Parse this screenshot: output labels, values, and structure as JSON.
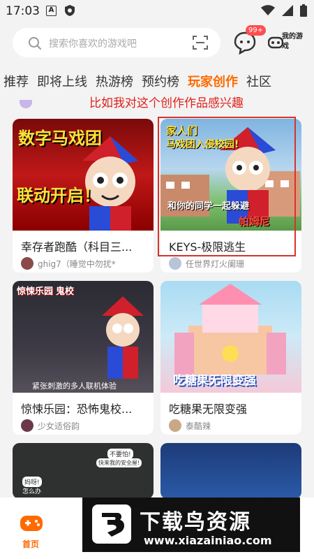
{
  "status": {
    "time": "17:03"
  },
  "search": {
    "placeholder": "搜索你喜欢的游戏吧"
  },
  "messages": {
    "badge": "99+"
  },
  "my_games": {
    "label": "我的游戏"
  },
  "tabs": [
    {
      "label": "推荐"
    },
    {
      "label": "即将上线"
    },
    {
      "label": "热游榜"
    },
    {
      "label": "预约榜"
    },
    {
      "label": "玩家创作",
      "active": true
    },
    {
      "label": "社区"
    }
  ],
  "annotation": "比如我对这个创作作品感兴趣",
  "cards": [
    {
      "title": "幸存者跑酷（科目三...",
      "author": "ghig7（睡觉中勿扰*",
      "thumb_text": [
        "数字马戏团",
        "联动开启！"
      ]
    },
    {
      "title": "KEYS-极限逃生",
      "author": "任世界灯火阑珊",
      "thumb_text": [
        "家人们",
        "马戏团入侵校园!",
        "和你的同学一起躲避",
        "帕姆尼"
      ]
    },
    {
      "title": "惊悚乐园：恐怖鬼校...",
      "author": "少女适俗韵",
      "thumb_text": [
        "惊悚乐园",
        "鬼校",
        "紧张刺激的多人联机体验"
      ]
    },
    {
      "title": "吃糖果无限变强",
      "author": "泰酷辣",
      "thumb_text": [
        "吃糖果无限变强"
      ]
    },
    {
      "title": "",
      "author": "",
      "thumb_text": [
        "不要怕!",
        "快来我的安全屋!",
        "妈呀!",
        "怎么办"
      ]
    }
  ],
  "bottom_nav": {
    "home_label": "首页"
  },
  "watermark": {
    "title": "下载鸟资源",
    "url": "www.xiazainiao.com"
  },
  "colors": {
    "accent": "#ff6a00",
    "annotation": "#e0201a",
    "badge": "#ff4d4f"
  }
}
